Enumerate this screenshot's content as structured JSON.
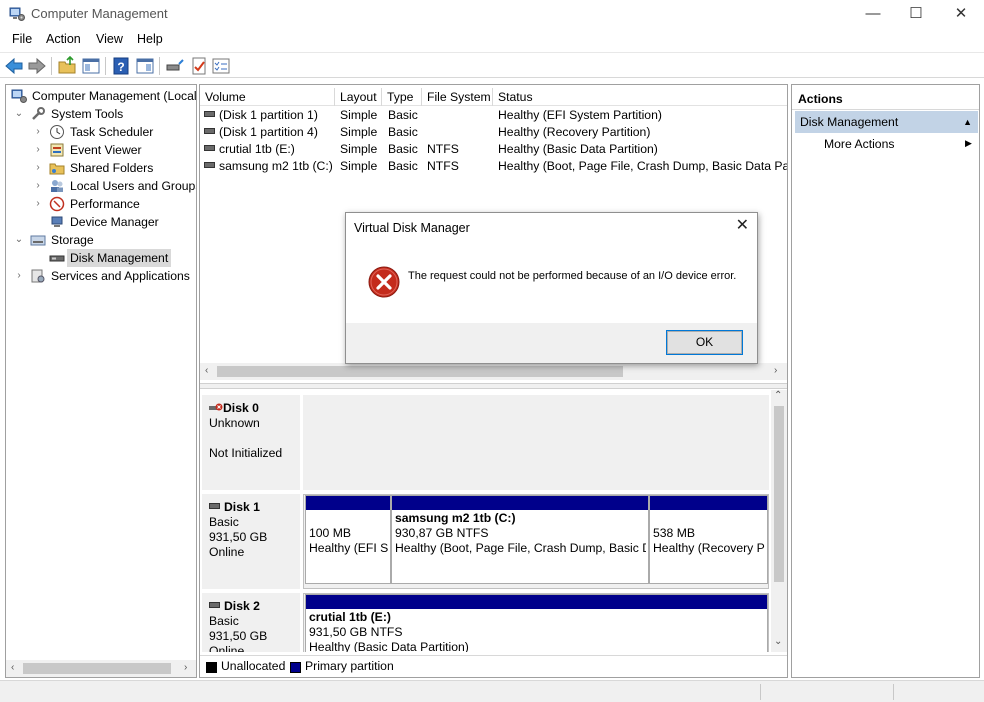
{
  "window": {
    "title": "Computer Management",
    "min_label": "—",
    "max_label": "☐",
    "close_label": "✕"
  },
  "menu": [
    "File",
    "Action",
    "View",
    "Help"
  ],
  "tree": {
    "root": "Computer Management (Local",
    "items": [
      {
        "label": "System Tools",
        "icon": "tools-icon"
      },
      {
        "label": "Task Scheduler",
        "icon": "clock-icon"
      },
      {
        "label": "Event Viewer",
        "icon": "event-viewer-icon"
      },
      {
        "label": "Shared Folders",
        "icon": "shared-folder-icon"
      },
      {
        "label": "Local Users and Groups",
        "icon": "users-icon"
      },
      {
        "label": "Performance",
        "icon": "performance-icon"
      },
      {
        "label": "Device Manager",
        "icon": "device-manager-icon"
      },
      {
        "label": "Storage",
        "icon": "storage-icon"
      },
      {
        "label": "Disk Management",
        "icon": "disk-management-icon"
      },
      {
        "label": "Services and Applications",
        "icon": "services-icon"
      }
    ],
    "collapse_glyph": "⌄",
    "expand_glyph": "›"
  },
  "volume_list": {
    "columns": [
      "Volume",
      "Layout",
      "Type",
      "File System",
      "Status"
    ],
    "rows": [
      [
        "(Disk 1 partition 1)",
        "Simple",
        "Basic",
        "",
        "Healthy (EFI System Partition)"
      ],
      [
        "(Disk 1 partition 4)",
        "Simple",
        "Basic",
        "",
        "Healthy (Recovery Partition)"
      ],
      [
        "crutial 1tb (E:)",
        "Simple",
        "Basic",
        "NTFS",
        "Healthy (Basic Data Partition)"
      ],
      [
        "samsung m2 1tb (C:)",
        "Simple",
        "Basic",
        "NTFS",
        "Healthy (Boot, Page File, Crash Dump, Basic Data Partit"
      ]
    ]
  },
  "disks": [
    {
      "name": "Disk 0",
      "lines": [
        "Unknown",
        "",
        "Not Initialized"
      ]
    },
    {
      "name": "Disk 1",
      "lines": [
        "Basic",
        "931,50 GB",
        "Online"
      ],
      "partitions": [
        {
          "name": "",
          "size": "100 MB",
          "status": "Healthy (EFI S"
        },
        {
          "name": "samsung m2 1tb  (C:)",
          "size": "930,87 GB NTFS",
          "status": "Healthy (Boot, Page File, Crash Dump, Basic D"
        },
        {
          "name": "",
          "size": "538 MB",
          "status": "Healthy (Recovery P"
        }
      ]
    },
    {
      "name": "Disk 2",
      "lines": [
        "Basic",
        "931,50 GB",
        "Online"
      ],
      "partitions": [
        {
          "name": "crutial 1tb  (E:)",
          "size": "931,50 GB NTFS",
          "status": "Healthy (Basic Data Partition)"
        }
      ]
    }
  ],
  "legend": [
    {
      "label": "Unallocated",
      "color": "#000000"
    },
    {
      "label": "Primary partition",
      "color": "#00008b"
    }
  ],
  "actions": {
    "header": "Actions",
    "section": "Disk Management",
    "more": "More Actions"
  },
  "dialog": {
    "title": "Virtual Disk Manager",
    "message": "The request could not be performed because of an I/O device error.",
    "ok": "OK"
  },
  "colors": {
    "selection": "#c2d3e6",
    "primary_partition": "#00008b",
    "error_red": "#c42b1c"
  }
}
